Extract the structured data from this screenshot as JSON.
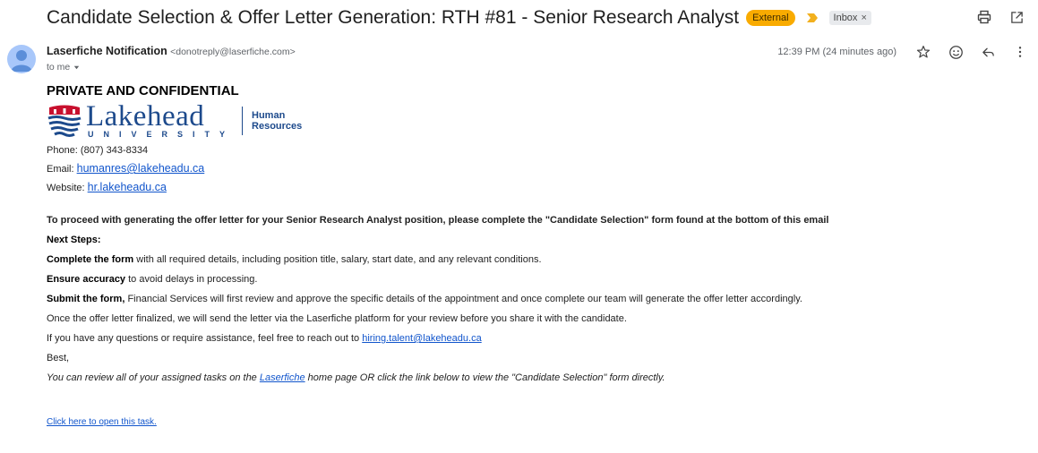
{
  "subject": "Candidate Selection & Offer Letter Generation: RTH #81 - Senior Research Analyst",
  "labels": {
    "external": "External",
    "inbox": "Inbox",
    "inbox_remove": "×"
  },
  "sender": {
    "name": "Laserfiche Notification",
    "email": "<donotreply@laserfiche.com>",
    "to": "to me"
  },
  "timestamp": "12:39 PM (24 minutes ago)",
  "icons": {
    "print": "print-icon",
    "popout": "open-in-new-window-icon",
    "star": "star-icon",
    "emoji": "emoji-icon",
    "reply": "reply-icon",
    "more": "more-vert-icon",
    "important": "important-marker-icon"
  },
  "body": {
    "private": "PRIVATE AND CONFIDENTIAL",
    "logo": {
      "word": "Lakehead",
      "sub": "UNIVERSITY",
      "dept_line1": "Human",
      "dept_line2": "Resources",
      "colors": {
        "blue": "#1d4a8c",
        "red": "#c8102e"
      }
    },
    "phone_label": "Phone: (807) 343-8334",
    "email_label": "Email:",
    "email_link": "humanres@lakeheadu.ca",
    "website_label": "Website:",
    "website_link": "hr.lakeheadu.ca",
    "lead": "To proceed with generating the offer letter for your Senior Research Analyst position, please complete the \"Candidate Selection\" form found at the bottom of this email",
    "next_steps": "Next Steps:",
    "step1_bold": "Complete the form",
    "step1_rest": " with all required details, including position title, salary, start date, and any relevant conditions.",
    "step2_bold": "Ensure accuracy",
    "step2_rest": " to avoid delays in processing.",
    "step3_bold": "Submit the form,",
    "step3_rest": " Financial Services will first review and approve the specific details of the appointment and once complete our team will generate the offer letter accordingly.",
    "line_finalized": "Once the offer letter finalized, we will send the letter via the Laserfiche platform for your review before you share it with the candidate.",
    "questions_text": "If you have any questions or require assistance, feel free to reach out to ",
    "questions_link": "hiring.talent@lakeheadu.ca",
    "best": "Best,",
    "review_before": "You can review all of your assigned tasks on the ",
    "review_link": "Laserfiche",
    "review_after": " home page OR click the link below to view the \"Candidate Selection\" form directly.",
    "open_task": "Click here to open this task."
  },
  "colors": {
    "accent_link": "#1155cc",
    "external_badge": "#f9ab00",
    "important_marker": "#f2b01e"
  }
}
